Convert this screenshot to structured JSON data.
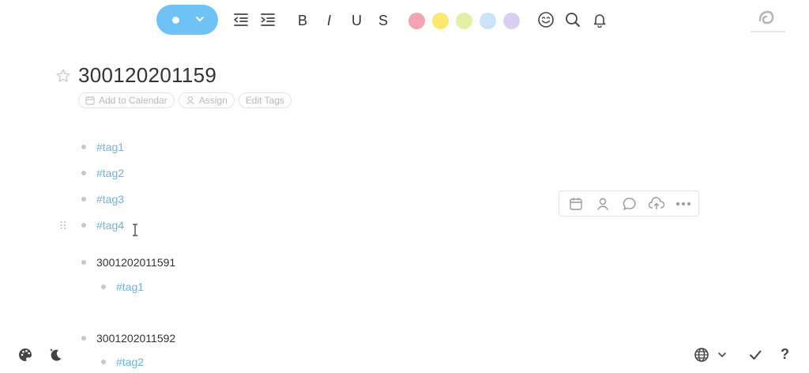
{
  "toolbar": {
    "formatting": {
      "bold": "B",
      "italic": "I",
      "underline": "U",
      "strike": "S"
    },
    "colors": [
      "#f4a3b3",
      "#fbe86e",
      "#e5f0a6",
      "#c9e3f7",
      "#d8d0f2"
    ],
    "icons": [
      "indent-decrease-icon",
      "indent-increase-icon",
      "emoji-icon",
      "search-icon",
      "bell-icon"
    ]
  },
  "page": {
    "title": "300120201159",
    "meta": {
      "add_to_calendar": "Add to Calendar",
      "assign": "Assign",
      "edit_tags": "Edit Tags"
    }
  },
  "items": [
    {
      "text": "#tag1",
      "kind": "tag"
    },
    {
      "text": "#tag2",
      "kind": "tag"
    },
    {
      "text": "#tag3",
      "kind": "tag"
    },
    {
      "text": "#tag4",
      "kind": "tag"
    },
    {
      "text": "3001202011591",
      "kind": "text"
    },
    {
      "text": "#tag1",
      "kind": "tag",
      "child": true
    },
    {
      "text": "3001202011592",
      "kind": "text"
    },
    {
      "text": "#tag2",
      "kind": "tag",
      "child": true
    }
  ],
  "hover_toolbar": [
    "calendar-icon",
    "person-icon",
    "comment-icon",
    "upload-icon",
    "more-icon"
  ],
  "bottom": {
    "help": "?"
  }
}
